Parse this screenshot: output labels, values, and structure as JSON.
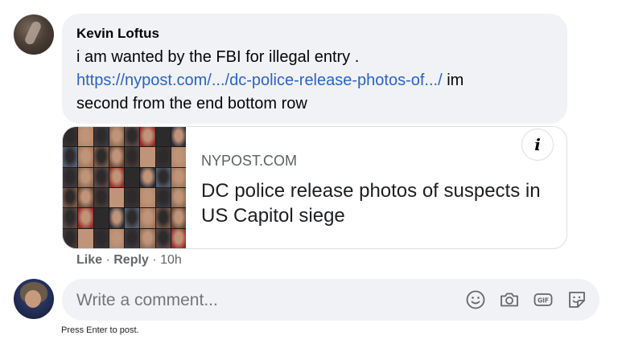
{
  "comment": {
    "author": "Kevin Loftus",
    "text_line1": "i am wanted by the FBI for illegal entry .",
    "link_text": "https://nypost.com/.../dc-police-release-photos-of.../",
    "text_after_link": " im",
    "text_line3": "second from the end bottom row"
  },
  "link_card": {
    "domain": "NYPOST.COM",
    "title": "DC police release photos of suspects in US Capitol siege",
    "info_label": "i"
  },
  "actions": {
    "like": "Like",
    "separator": "·",
    "reply": "Reply",
    "time": "10h"
  },
  "composer": {
    "placeholder": "Write a comment...",
    "icons": [
      "emoji-icon",
      "camera-icon",
      "gif-icon",
      "sticker-icon"
    ],
    "hint": "Press Enter to post."
  },
  "colors": {
    "link": "#2b63c7",
    "bubble_bg": "#f0f2f5",
    "meta_text": "#65676b"
  }
}
